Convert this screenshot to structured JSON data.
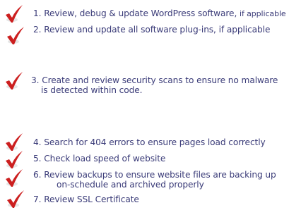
{
  "checkmark_color": "#cc1f1f",
  "checkmark_icon": "check-icon",
  "text_color": "#3a3b78",
  "items": [
    {
      "number": "1.",
      "text": "Review, debug & update WordPress software,",
      "suffix": "if applicable"
    },
    {
      "number": "2.",
      "text": "Review and update all software plug-ins, if applicable"
    },
    {
      "number": "3.",
      "text": "Create and review security scans to ensure no malware",
      "text_cont": "is detected within code."
    },
    {
      "number": "4.",
      "text": "Search for 404 errors to ensure pages load correctly"
    },
    {
      "number": "5.",
      "text": "Check load speed of website"
    },
    {
      "number": "6.",
      "text": "Review backups to ensure website files are backing up",
      "text_cont": "on-schedule and archived properly"
    },
    {
      "number": "7.",
      "text": "Review SSL Certificate"
    }
  ]
}
